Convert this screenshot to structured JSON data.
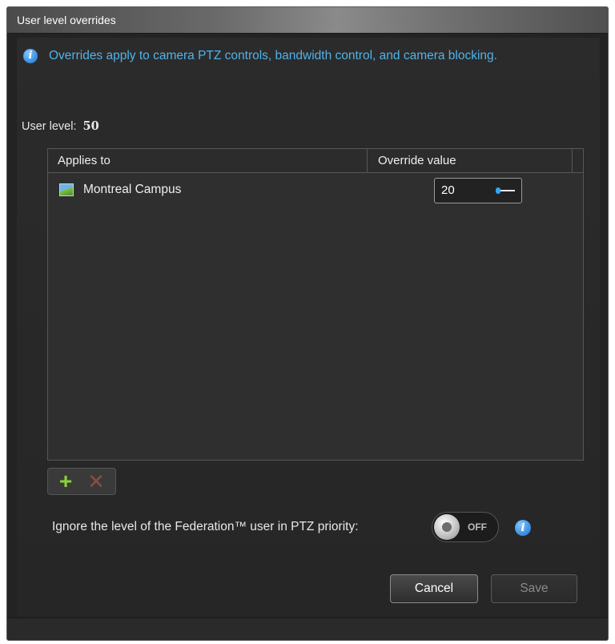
{
  "window": {
    "title": "User level overrides"
  },
  "info": {
    "text": "Overrides apply to camera PTZ controls, bandwidth control, and camera blocking."
  },
  "user_level": {
    "label": "User level:",
    "value": "50"
  },
  "table": {
    "columns": [
      "Applies to",
      "Override value"
    ],
    "rows": [
      {
        "name": "Montreal Campus",
        "value": "20",
        "icon": "site-icon"
      }
    ]
  },
  "toolbar": {
    "add_icon": "plus-icon",
    "delete_icon": "x-icon"
  },
  "federation": {
    "label": "Ignore the level of the Federation™ user in PTZ priority:",
    "toggle_state": "OFF"
  },
  "buttons": {
    "cancel": "Cancel",
    "save": "Save"
  },
  "colors": {
    "info_text": "#4fb3ea",
    "accent_blue": "#2ea8ff",
    "add_green": "#8fd13a"
  }
}
